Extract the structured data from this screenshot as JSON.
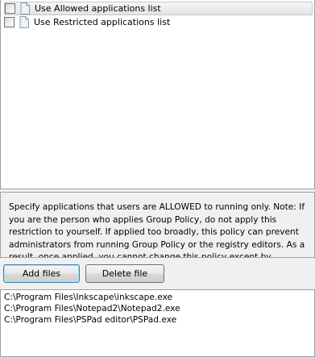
{
  "options": [
    {
      "label": "Use Allowed applications list",
      "checked": false,
      "selected": true
    },
    {
      "label": "Use Restricted applications list",
      "checked": false,
      "selected": false
    }
  ],
  "description": "Specify applications that users are ALLOWED to running only. Note: If you are the person who applies Group Policy, do not apply this restriction to yourself. If applied too broadly, this policy can prevent administrators from running Group Policy or the registry editors. As a result, once applied, you cannot change this policy except by reinstalling Windows.",
  "buttons": {
    "add_files": "Add files",
    "delete_file": "Delete file"
  },
  "files": [
    "C:\\Program Files\\Inkscape\\inkscape.exe",
    "C:\\Program Files\\Notepad2\\Notepad2.exe",
    "C:\\Program Files\\PSPad editor\\PSPad.exe"
  ]
}
